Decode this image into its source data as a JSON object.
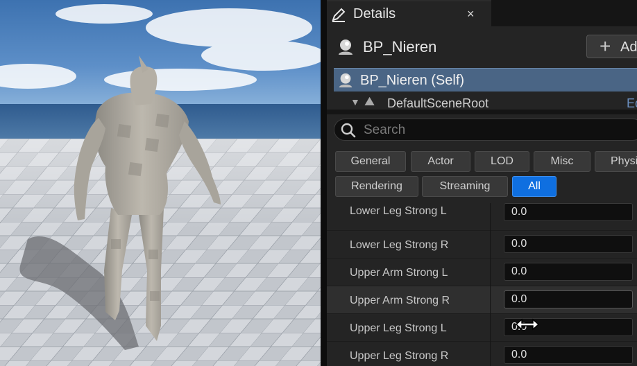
{
  "details_tab": {
    "title": "Details",
    "close": "×",
    "icon": "pencil-icon"
  },
  "header": {
    "blueprint_name": "BP_Nieren",
    "add_button_label": "Add"
  },
  "components": {
    "self_label": "BP_Nieren (Self)",
    "root_label": "DefaultSceneRoot",
    "root_right_text": "Ed"
  },
  "search": {
    "placeholder": "Search",
    "value": ""
  },
  "filters": {
    "row1": [
      "General",
      "Actor",
      "LOD",
      "Misc",
      "Physi"
    ],
    "row2": [
      "Rendering",
      "Streaming",
      "All"
    ],
    "active": "All"
  },
  "properties": [
    {
      "label": "Lower Leg Strong L",
      "value": "0.0"
    },
    {
      "label": "Lower Leg Strong R",
      "value": "0.0"
    },
    {
      "label": "Upper Arm Strong L",
      "value": "0.0"
    },
    {
      "label": "Upper Arm Strong R",
      "value": "0.0"
    },
    {
      "label": "Upper Leg Strong L",
      "value": "0.0"
    },
    {
      "label": "Upper Leg Strong R",
      "value": "0.0"
    }
  ],
  "colors": {
    "accent_active": "#0f6fe0",
    "selection": "#4a6585",
    "panel_bg": "#242424"
  }
}
